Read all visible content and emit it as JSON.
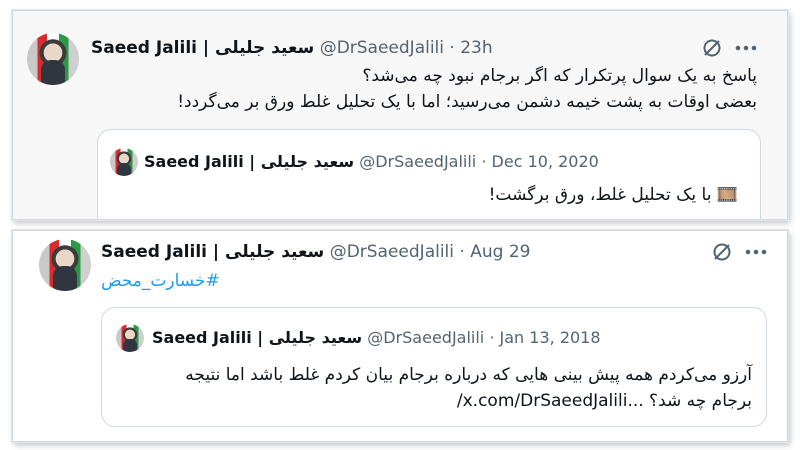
{
  "tweets": [
    {
      "author_name": "Saeed Jalili | سعید جلیلی",
      "handle": "@DrSaeedJalili",
      "separator": "·",
      "time": "23h",
      "text_lines": [
        "پاسخ به یک سوال پرتکرار که اگر برجام نبود چه می‌شد؟",
        "بعضی اوقات به پشت خیمه دشمن می‌رسید؛ اما با یک تحلیل غلط ورق بر می‌گردد!"
      ],
      "quote": {
        "author_name": "Saeed Jalili | سعید جلیلی",
        "handle": "@DrSaeedJalili",
        "separator": "·",
        "time": "Dec 10, 2020",
        "text": "🎞️ با یک تحلیل غلط، ورق برگشت!"
      }
    },
    {
      "author_name": "Saeed Jalili | سعید جلیلی",
      "handle": "@DrSaeedJalili",
      "separator": "·",
      "time": "Aug 29",
      "text": "#خسارت_محض",
      "quote": {
        "author_name": "Saeed Jalili | سعید جلیلی",
        "handle": "@DrSaeedJalili",
        "separator": "·",
        "time": "Jan 13, 2018",
        "text_lines": [
          "آرزو می‌کردم همه پیش بینی هایی که درباره برجام بیان کردم غلط باشد اما نتیجه",
          "برجام چه شد؟ ...x.com/DrSaeedJalili/"
        ]
      }
    }
  ],
  "icons": {
    "grok": "grok-icon",
    "more": "more-icon",
    "avatar": "avatar"
  },
  "colors": {
    "text": "#0f1419",
    "secondary": "#536471",
    "link": "#1d9bf0",
    "border": "#cfd9de"
  }
}
